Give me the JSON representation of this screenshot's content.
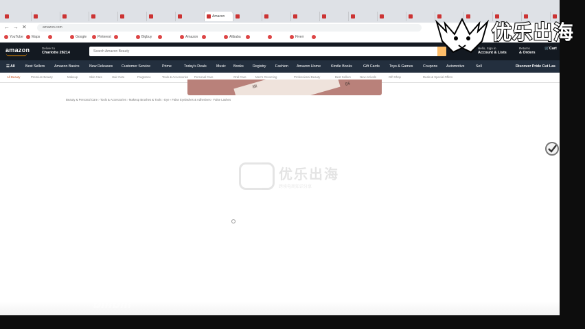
{
  "browser": {
    "tabs": [
      "",
      "",
      "",
      "",
      "",
      "",
      "",
      "Amazon",
      "",
      "",
      "",
      "",
      "",
      "",
      "",
      "",
      "",
      "",
      "",
      ""
    ],
    "active_tab_index": 7,
    "url": "amazon.com",
    "bookmarks": [
      "YouTube",
      "Maps",
      "",
      "Google",
      "Pinterest",
      "",
      "Bigbuy",
      "",
      "Amazon",
      "",
      "Alibaba",
      "",
      "",
      "Fiverr",
      ""
    ]
  },
  "amazon": {
    "logo": "amazon",
    "deliver_to_label": "Deliver to",
    "deliver_to_location": "Charlotte 28214",
    "search_placeholder": "Search Amazon Beauty",
    "account_greeting": "Hello, Sign in",
    "account_label": "Account & Lists",
    "orders_top": "Returns",
    "orders_label": "& Orders",
    "cart_label": "Cart",
    "nav_all": "All",
    "nav_items": [
      "Best Sellers",
      "Amazon Basics",
      "New Releases",
      "Customer Service",
      "Prime",
      "Today's Deals",
      "Music",
      "Books",
      "Registry",
      "Fashion",
      "Amazon Home",
      "Kindle Books",
      "Gift Cards",
      "Toys & Games",
      "Coupons",
      "Automotive",
      "Sell"
    ],
    "nav_promo": "Discover Pride Cut Las",
    "subnav_items": [
      "All Beauty",
      "Premium Beauty",
      "Makeup",
      "Skin Care",
      "Hair Care",
      "Fragrance",
      "Tools & Accessories",
      "Personal Care",
      "Oral Care",
      "Men's Grooming",
      "Professional Beauty",
      "Best Sellers",
      "New Arrivals",
      "Gift Shop",
      "Deals & Special Offers"
    ],
    "breadcrumb": "Beauty & Personal Care › Tools & Accessories › Makeup Brushes & Tools › Eye › False Eyelashes & Adhesives › False Lashes",
    "banner_texts": [
      "lilli",
      "B6"
    ]
  },
  "overlay": {
    "corner_brand": "优乐出海",
    "center_watermark": "优乐出海",
    "center_watermark_sub": "跨境电商知识分享",
    "platform_mark": "bilibili"
  },
  "colors": {
    "amazon_dark": "#131921",
    "amazon_nav": "#232f3e",
    "amazon_orange": "#ff9900",
    "search_button": "#febd69",
    "banner": "#b9817a"
  }
}
